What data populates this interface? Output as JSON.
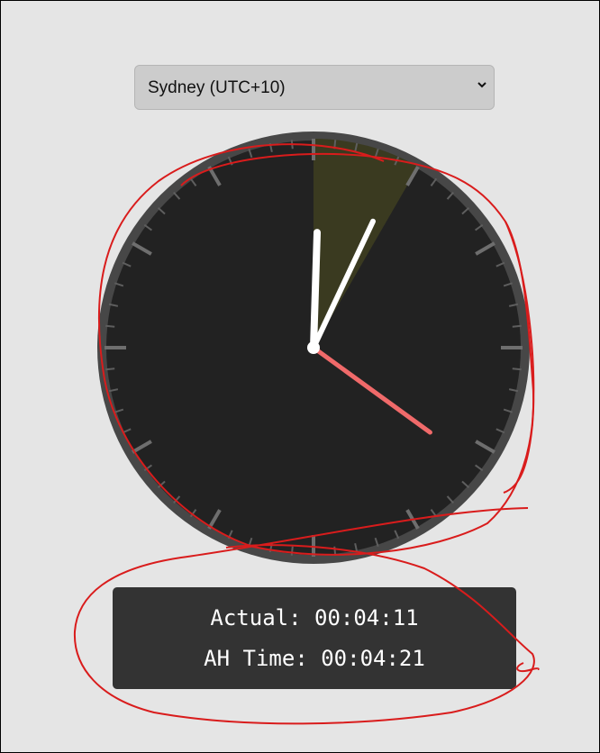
{
  "timezone_select": {
    "selected": "Sydney (UTC+10)"
  },
  "clock": {
    "face_color": "#222222",
    "rim_color": "#474747",
    "tick_color": "#5e5e5e",
    "major_tick_color": "#6e6e6e",
    "hand_color": "#ffffff",
    "second_hand_color": "#f06a6a",
    "sector_color": "#3a3a20",
    "sector_start_minutes": 0,
    "sector_end_minutes": 5,
    "hour_hand_minutes": 0.3,
    "minute_hand_minutes": 4.2,
    "second_hand_seconds": 21
  },
  "readout": {
    "actual_label": "Actual:",
    "actual_value": "00:04:11",
    "ah_label": "AH Time:",
    "ah_value": "00:04:21"
  },
  "annotation_color": "#d91c1c"
}
